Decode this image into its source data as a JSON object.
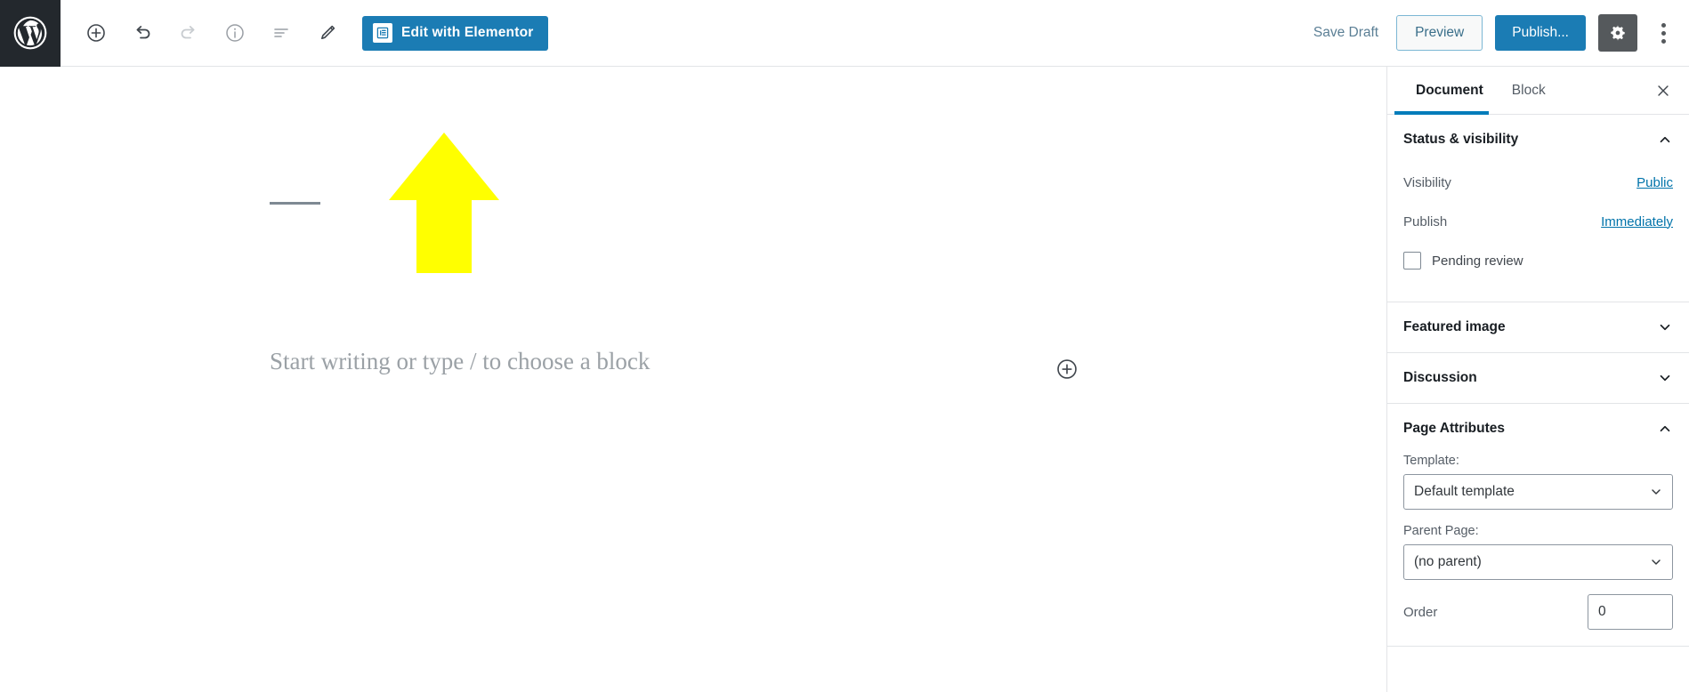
{
  "toolbar": {
    "logo_icon": "wordpress-logo-icon",
    "icons": [
      {
        "name": "add-block-icon",
        "state": "enabled"
      },
      {
        "name": "undo-icon",
        "state": "enabled"
      },
      {
        "name": "redo-icon",
        "state": "disabled"
      },
      {
        "name": "info-icon",
        "state": "enabled"
      },
      {
        "name": "list-view-icon",
        "state": "enabled"
      },
      {
        "name": "edit-pencil-icon",
        "state": "enabled"
      }
    ],
    "elementor_button": {
      "label": "Edit with Elementor",
      "icon": "elementor-document-icon",
      "background": "#1b7cb4"
    },
    "save_draft_label": "Save Draft",
    "preview_label": "Preview",
    "publish_label": "Publish...",
    "settings_icon": "gear-icon",
    "more_menu_icon": "kebab-menu-icon"
  },
  "editor": {
    "title_placeholder_rule": true,
    "block_placeholder": "Start writing or type / to choose a block",
    "inserter_icon": "circle-plus-icon"
  },
  "annotation": {
    "shape": "up-arrow",
    "color": "#FFFF00",
    "points_to": "Edit with Elementor"
  },
  "sidebar": {
    "tabs": [
      {
        "label": "Document",
        "active": true
      },
      {
        "label": "Block",
        "active": false
      }
    ],
    "close_icon": "close-icon",
    "accent_color": "#007cba",
    "panels": [
      {
        "title": "Status & visibility",
        "expanded": true,
        "chevron": "chevron-up-icon",
        "rows": [
          {
            "label": "Visibility",
            "value": "Public"
          },
          {
            "label": "Publish",
            "value": "Immediately"
          }
        ],
        "checkbox": {
          "label": "Pending review",
          "checked": false
        }
      },
      {
        "title": "Featured image",
        "expanded": false,
        "chevron": "chevron-down-icon"
      },
      {
        "title": "Discussion",
        "expanded": false,
        "chevron": "chevron-down-icon"
      },
      {
        "title": "Page Attributes",
        "expanded": true,
        "chevron": "chevron-up-icon",
        "fields": [
          {
            "label": "Template:",
            "value": "Default template",
            "type": "select"
          },
          {
            "label": "Parent Page:",
            "value": "(no parent)",
            "type": "select"
          },
          {
            "label": "Order",
            "value": "0",
            "type": "number"
          }
        ]
      }
    ]
  }
}
